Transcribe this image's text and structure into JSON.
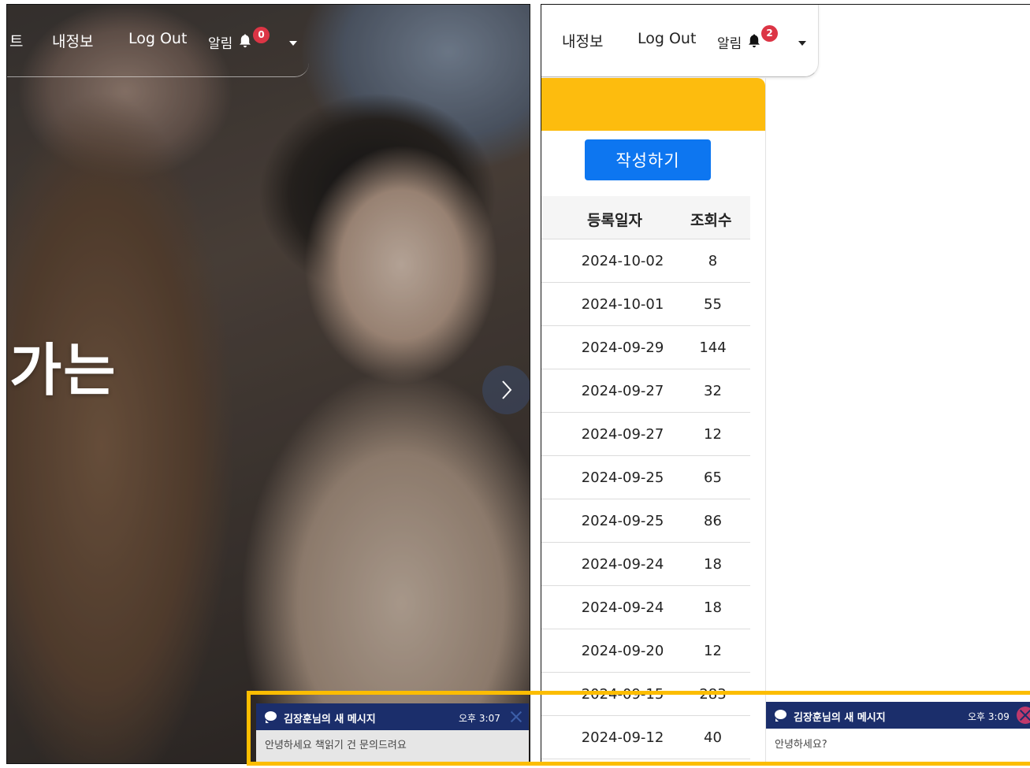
{
  "left_window": {
    "nav": {
      "partial_item": "트",
      "my_info": "내정보",
      "logout": "Log Out",
      "alarm_label": "알림",
      "alarm_count": "0"
    },
    "hero_text": "가는"
  },
  "right_window": {
    "nav": {
      "my_info": "내정보",
      "logout": "Log Out",
      "alarm_label": "알림",
      "alarm_count": "2"
    },
    "board": {
      "write_button": "작성하기",
      "columns": {
        "date": "등록일자",
        "views": "조회수"
      },
      "rows": [
        {
          "date": "2024-10-02",
          "views": "8"
        },
        {
          "date": "2024-10-01",
          "views": "55"
        },
        {
          "date": "2024-09-29",
          "views": "144"
        },
        {
          "date": "2024-09-27",
          "views": "32"
        },
        {
          "date": "2024-09-27",
          "views": "12"
        },
        {
          "date": "2024-09-25",
          "views": "65"
        },
        {
          "date": "2024-09-25",
          "views": "86"
        },
        {
          "date": "2024-09-24",
          "views": "18"
        },
        {
          "date": "2024-09-24",
          "views": "18"
        },
        {
          "date": "2024-09-20",
          "views": "12"
        },
        {
          "date": "2024-09-15",
          "views": "283"
        },
        {
          "date": "2024-09-12",
          "views": "40"
        }
      ]
    }
  },
  "toasts": [
    {
      "title": "김장훈님의 새 메시지",
      "time": "오후 3:07",
      "message": "안녕하세요 책읽기 건 문의드려요"
    },
    {
      "title": "김장훈님의 새 메시지",
      "time": "오후 3:09",
      "message": "안녕하세요?"
    }
  ],
  "colors": {
    "board_header": "#fdbc0e",
    "write_button": "#0d76f0",
    "toast_header": "#1b2e6b",
    "badge": "#dc3545",
    "highlight_border": "#fcbd00"
  }
}
